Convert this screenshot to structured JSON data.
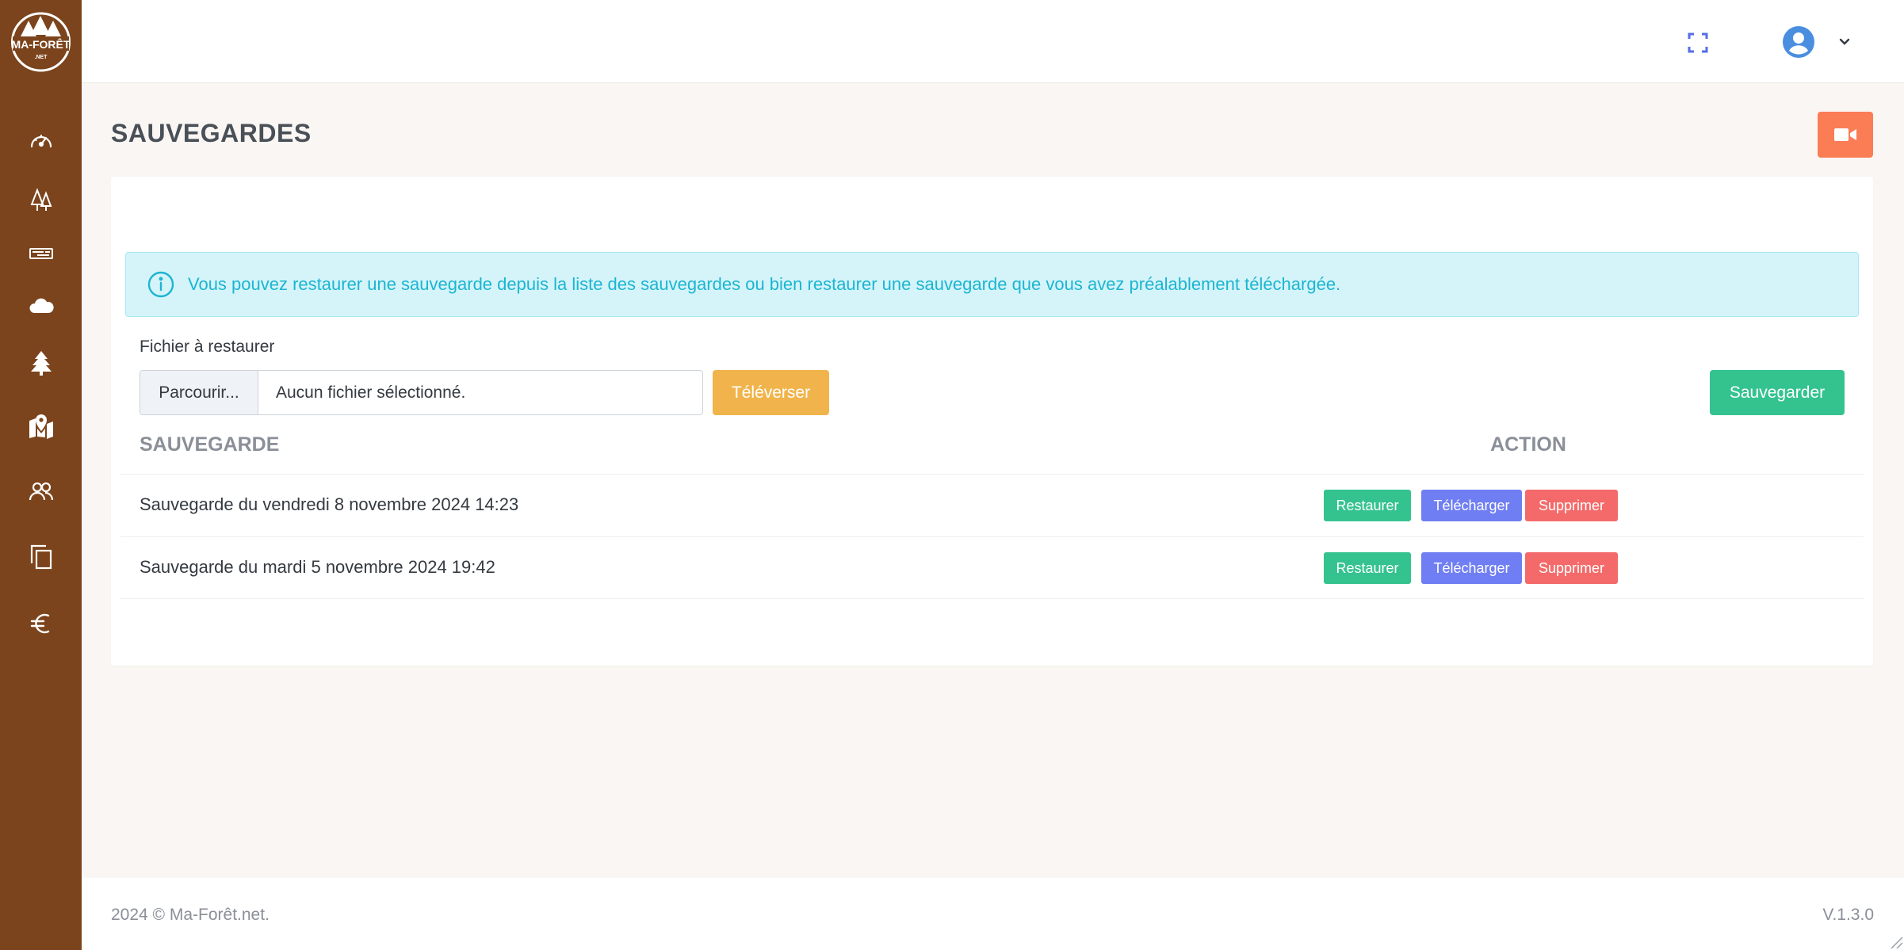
{
  "app": {
    "logo_text": "MA-FORÊT",
    "logo_sub": ".NET"
  },
  "sidebar": {
    "items": [
      {
        "icon": "dashboard-gauge-icon"
      },
      {
        "icon": "trees-icon"
      },
      {
        "icon": "wood-log-icon"
      },
      {
        "icon": "cloud-weather-icon"
      },
      {
        "icon": "fir-tree-icon"
      },
      {
        "icon": "map-marker-icon"
      },
      {
        "icon": "users-icon"
      },
      {
        "icon": "documents-copy-icon"
      },
      {
        "icon": "euro-icon"
      }
    ]
  },
  "topbar": {
    "fullscreen_icon": "fullscreen-icon",
    "user_icon": "user-avatar-icon",
    "menu_icon": "chevron-down-icon"
  },
  "page": {
    "title": "SAUVEGARDES",
    "video_icon": "video-camera-icon"
  },
  "alert": {
    "text": "Vous pouvez restaurer une sauvegarde depuis la liste des sauvegardes ou bien restaurer une sauvegarde que vous avez préalablement téléchargée."
  },
  "upload": {
    "label": "Fichier à restaurer",
    "browse_label": "Parcourir...",
    "file_value": "Aucun fichier sélectionné.",
    "upload_button": "Téléverser",
    "save_button": "Sauvegarder"
  },
  "table": {
    "headers": [
      "SAUVEGARDE",
      "ACTION"
    ],
    "rows": [
      {
        "name": "Sauvegarde du vendredi 8 novembre 2024 14:23"
      },
      {
        "name": "Sauvegarde du mardi 5 novembre 2024 19:42"
      }
    ],
    "actions": {
      "restore": "Restaurer",
      "download": "Télécharger",
      "delete": "Supprimer"
    }
  },
  "footer": {
    "copyright": "2024 © Ma-Forêt.net.",
    "version": "V.1.3.0"
  },
  "colors": {
    "sidebar": "#7b441c",
    "success": "#34c38f",
    "warning": "#f1b44c",
    "primary": "#6f7ef2",
    "danger": "#f46a6a",
    "video": "#fa7d55",
    "info": "#1cb5d1"
  }
}
